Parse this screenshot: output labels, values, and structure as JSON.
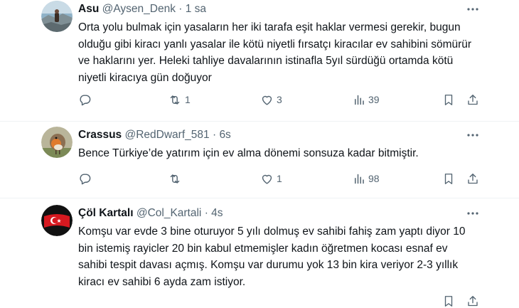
{
  "tweets": [
    {
      "name": "Asu",
      "handle": "@Aysen_Denk",
      "time": "1 sa",
      "text": "Orta yolu bulmak için yasaların her iki tarafa eşit haklar vermesi gerekir, bugun olduğu gibi kiracı yanlı yasalar ile kötü niyetli fırsatçı kiracılar ev sahibini sömürür ve haklarını yer. Heleki tahliye davalarının istinafla 5yıl sürdüğü ortamda kötü niyetli kiracıya gün doğuyor",
      "stats": {
        "replies": "",
        "retweets": "1",
        "likes": "3",
        "views": "39"
      }
    },
    {
      "name": "Crassus",
      "handle": "@RedDwarf_581",
      "time": "6s",
      "text": "Bence Türkiye’de yatırım için ev alma dönemi sonsuza kadar bitmiştir.",
      "stats": {
        "replies": "",
        "retweets": "",
        "likes": "1",
        "views": "98"
      }
    },
    {
      "name": "Çöl Kartalı",
      "handle": "@Col_Kartali",
      "time": "4s",
      "text": "Komşu var evde 3 bine oturuyor 5 yılı dolmuş  ev sahibi fahiş zam yaptı diyor 10 bin istemiş rayicler 20 bin kabul etmemişler kadın öğretmen kocası esnaf ev sahibi tespit davası açmış. Komşu var durumu yok 13 bin kira veriyor 2-3 yıllık kiracı ev sahibi 6 ayda zam istiyor.",
      "stats": {
        "replies": "",
        "retweets": "",
        "likes": "",
        "views": ""
      }
    }
  ],
  "separator": "·",
  "colors": {
    "text": "#0f1419",
    "secondary": "#536471",
    "divider": "#eff3f4"
  },
  "icons": [
    "reply-icon",
    "retweet-icon",
    "like-icon",
    "views-icon",
    "bookmark-icon",
    "share-icon",
    "more-icon"
  ]
}
